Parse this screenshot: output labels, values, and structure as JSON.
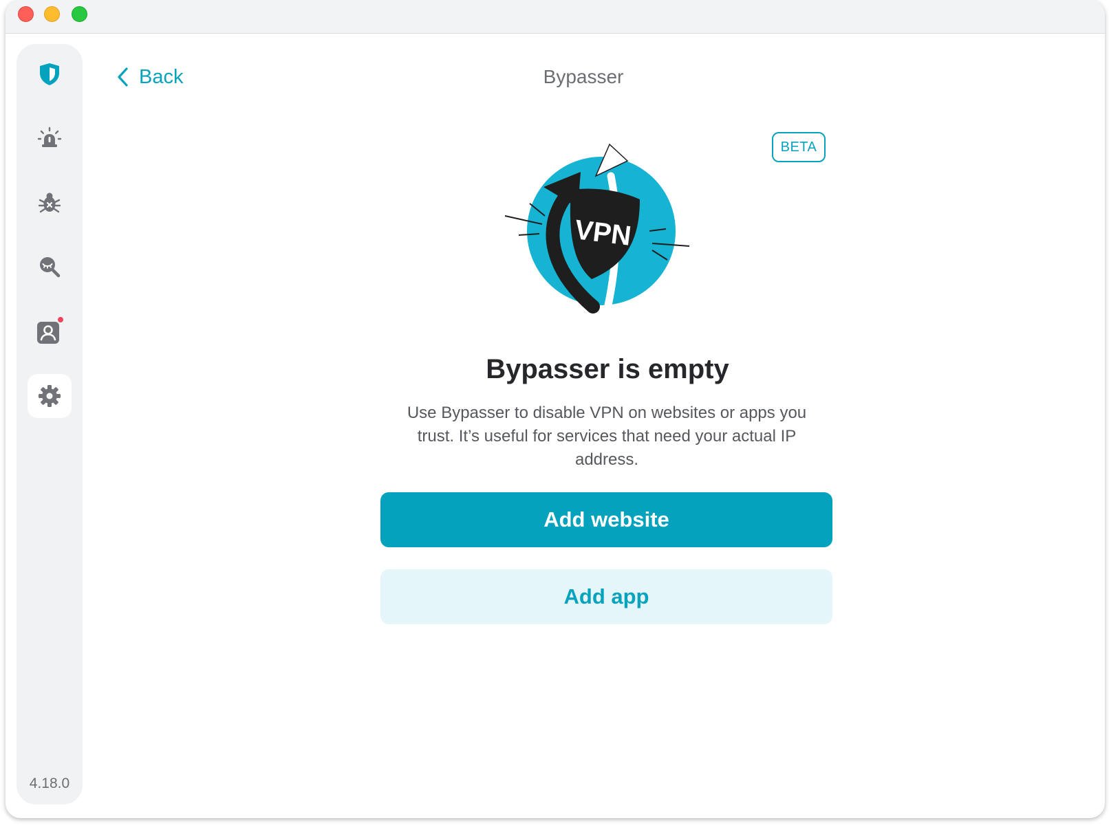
{
  "window": {
    "controls": [
      "close",
      "minimize",
      "zoom"
    ]
  },
  "sidebar": {
    "items": [
      {
        "name": "shield",
        "icon": "shield-icon",
        "active": false
      },
      {
        "name": "alarm",
        "icon": "alarm-icon",
        "active": false
      },
      {
        "name": "bug",
        "icon": "bug-icon",
        "active": false
      },
      {
        "name": "search",
        "icon": "eye-search-icon",
        "active": false
      },
      {
        "name": "account",
        "icon": "account-icon",
        "active": false,
        "badge": true
      },
      {
        "name": "settings",
        "icon": "gear-icon",
        "active": true
      }
    ],
    "version": "4.18.0"
  },
  "header": {
    "back_label": "Back",
    "title": "Bypasser"
  },
  "badge": {
    "label": "BETA"
  },
  "illustration": {
    "shield_text": "VPN"
  },
  "empty_state": {
    "title": "Bypasser is empty",
    "description": "Use Bypasser to disable VPN on websites or apps you trust. It’s useful for services that need your actual IP address.",
    "primary_button": "Add website",
    "secondary_button": "Add app"
  },
  "colors": {
    "accent": "#04a2bc",
    "accent_light": "#e5f6fa",
    "notification_dot": "#f0455e"
  }
}
